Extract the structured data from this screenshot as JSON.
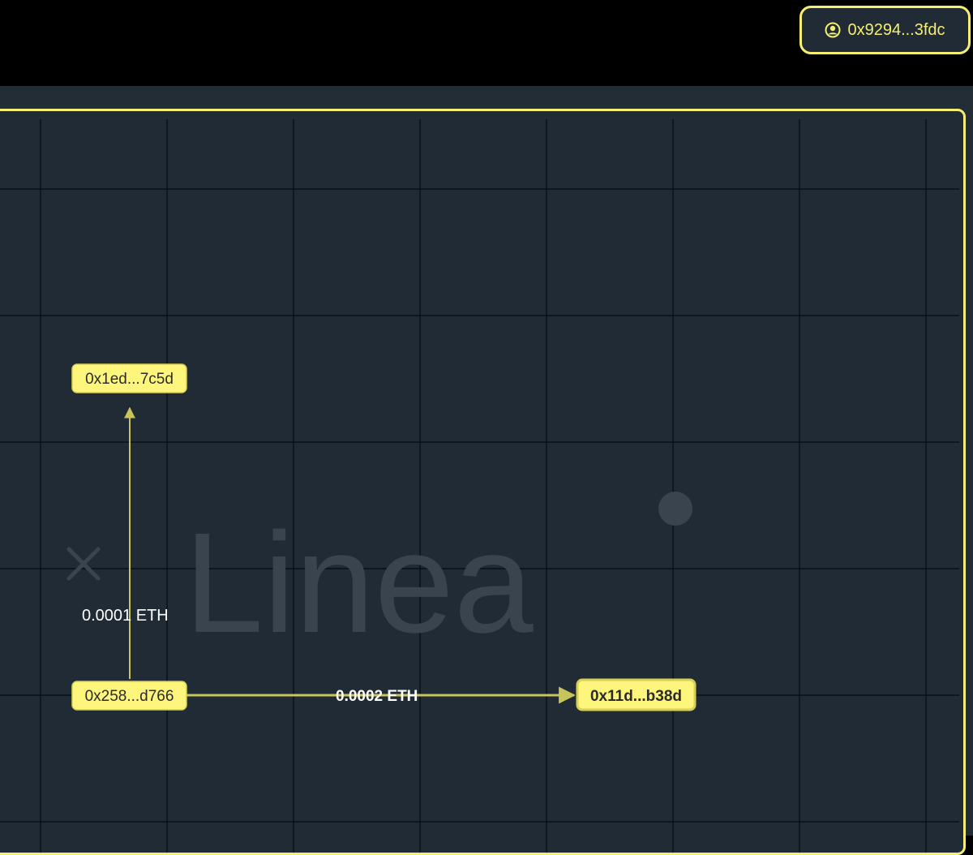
{
  "header": {
    "wallet_address": "0x9294...3fdc",
    "wallet_icon": "user-circle-icon"
  },
  "graph": {
    "watermark_text": "Linea",
    "watermark_icon": "close-icon",
    "nodes": [
      {
        "id": "n1",
        "label": "0x1ed...7c5d",
        "highlighted": false
      },
      {
        "id": "n2",
        "label": "0x258...d766",
        "highlighted": false
      },
      {
        "id": "n3",
        "label": "0x11d...b38d",
        "highlighted": true
      }
    ],
    "edges": [
      {
        "from": "n2",
        "to": "n1",
        "label": "0.0001 ETH"
      },
      {
        "from": "n2",
        "to": "n3",
        "label": "0.0002 ETH"
      }
    ]
  },
  "colors": {
    "accent": "#f5ee72",
    "node_fill": "#fdf57c",
    "node_text": "#2b2b2b",
    "edge": "#c8c45a",
    "grid": "#0b0f13",
    "panel_bg": "#212b35",
    "watermark": "#3a444e"
  }
}
